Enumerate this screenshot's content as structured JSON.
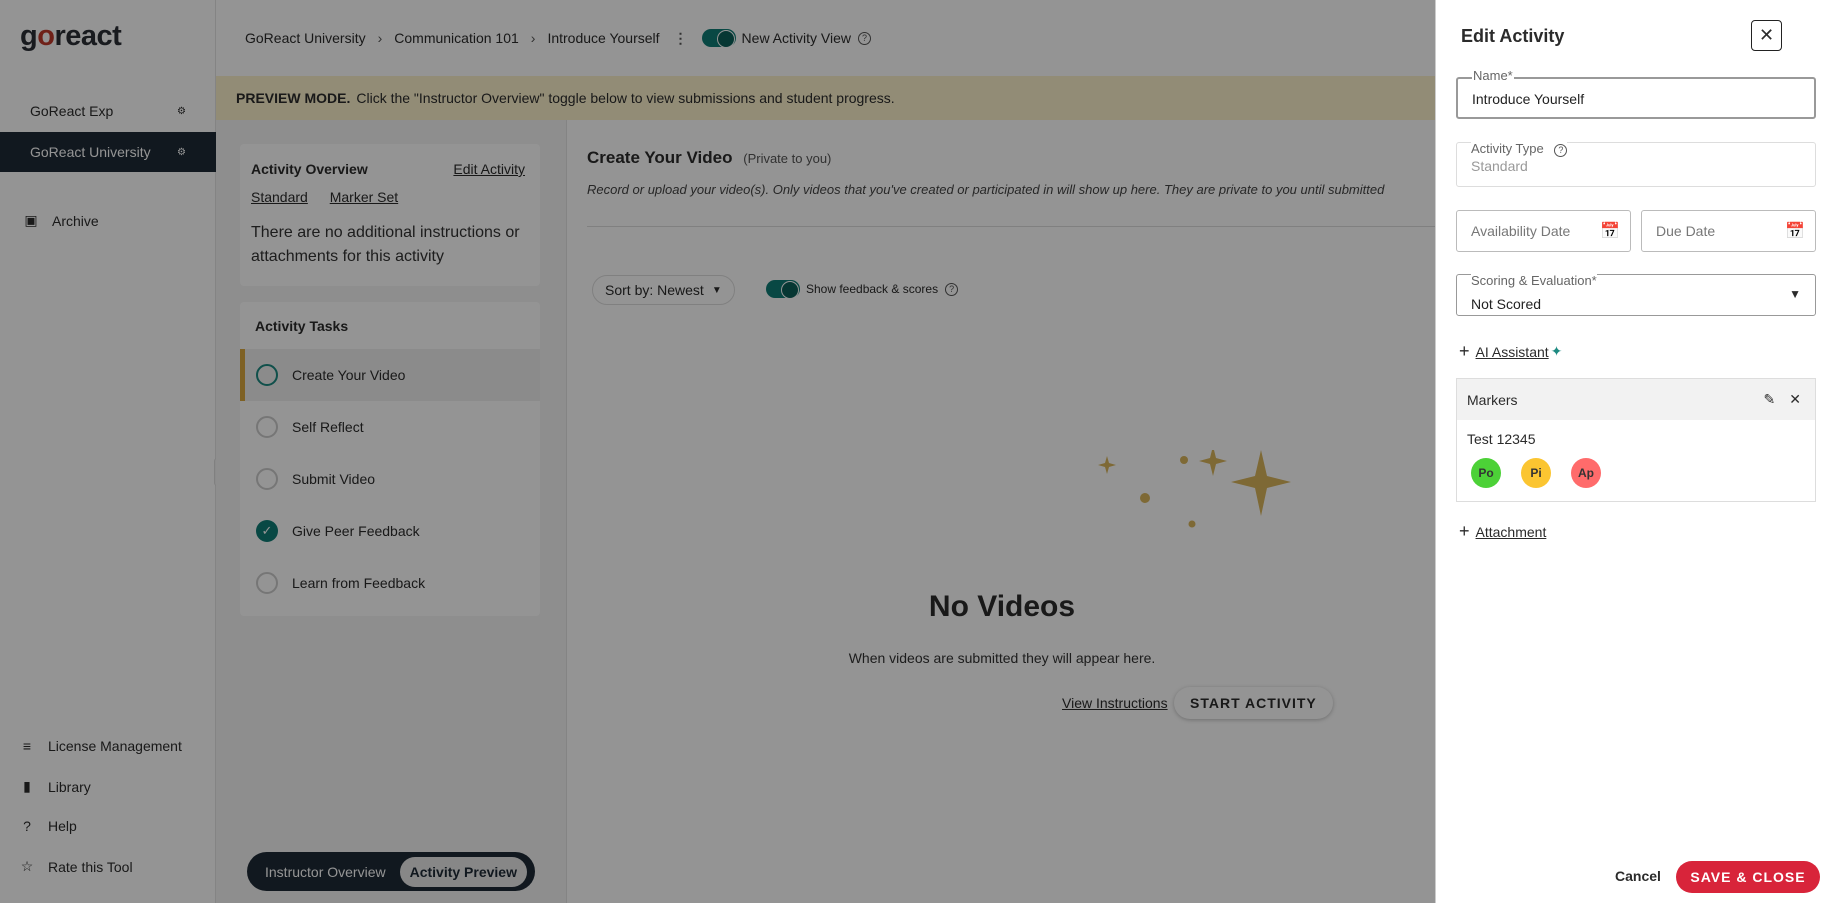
{
  "sidebar": {
    "logo": "goreact",
    "groups": [
      {
        "label": "GoReact Exp"
      },
      {
        "label": "GoReact University"
      }
    ],
    "archive_label": "Archive",
    "bottom_items": [
      {
        "label": "License Management",
        "icon": "list-icon"
      },
      {
        "label": "Library",
        "icon": "library-icon"
      },
      {
        "label": "Help",
        "icon": "help-icon"
      },
      {
        "label": "Rate this Tool",
        "icon": "star-icon"
      }
    ]
  },
  "header": {
    "breadcrumbs": [
      "GoReact University",
      "Communication 101",
      "Introduce Yourself"
    ],
    "view_toggle_label": "New Activity View"
  },
  "banner": {
    "bold": "PREVIEW MODE.",
    "text": "Click the \"Instructor Overview\" toggle below to view submissions and student progress."
  },
  "overview": {
    "title": "Activity Overview",
    "edit_link": "Edit Activity",
    "links": [
      "Standard",
      "Marker Set"
    ],
    "text": "There are no additional instructions or attachments for this activity"
  },
  "tasks": {
    "title": "Activity Tasks",
    "items": [
      {
        "label": "Create Your Video",
        "state": "active"
      },
      {
        "label": "Self Reflect",
        "state": "todo"
      },
      {
        "label": "Submit Video",
        "state": "todo"
      },
      {
        "label": "Give Peer Feedback",
        "state": "done"
      },
      {
        "label": "Learn from Feedback",
        "state": "todo"
      }
    ]
  },
  "switcher": {
    "a": "Instructor Overview",
    "b": "Activity Preview"
  },
  "main": {
    "title": "Create Your Video",
    "subtitle": "(Private to you)",
    "description": "Record or upload your video(s). Only videos that you've created or participated in will show up here. They are private to you until submitted",
    "sort_label": "Sort by: Newest",
    "feedback_label": "Show feedback & scores",
    "empty_title": "No Videos",
    "empty_sub": "When videos are submitted they will appear here.",
    "view_instructions": "View Instructions",
    "start_button": "START ACTIVITY"
  },
  "drawer": {
    "title": "Edit Activity",
    "name_label": "Name*",
    "name_value": "Introduce Yourself",
    "type_label": "Activity Type",
    "type_value": "Standard",
    "availability_placeholder": "Availability Date",
    "due_placeholder": "Due Date",
    "scoring_label": "Scoring & Evaluation*",
    "scoring_value": "Not Scored",
    "ai_label": "AI Assistant",
    "markers_title": "Markers",
    "marker_set_name": "Test 12345",
    "marker_chips": [
      {
        "label": "Po",
        "color": "#4cd137"
      },
      {
        "label": "Pi",
        "color": "#fbc531"
      },
      {
        "label": "Ap",
        "color": "#ff6b6b"
      }
    ],
    "attachment_label": "Attachment",
    "cancel": "Cancel",
    "save": "SAVE & CLOSE"
  }
}
